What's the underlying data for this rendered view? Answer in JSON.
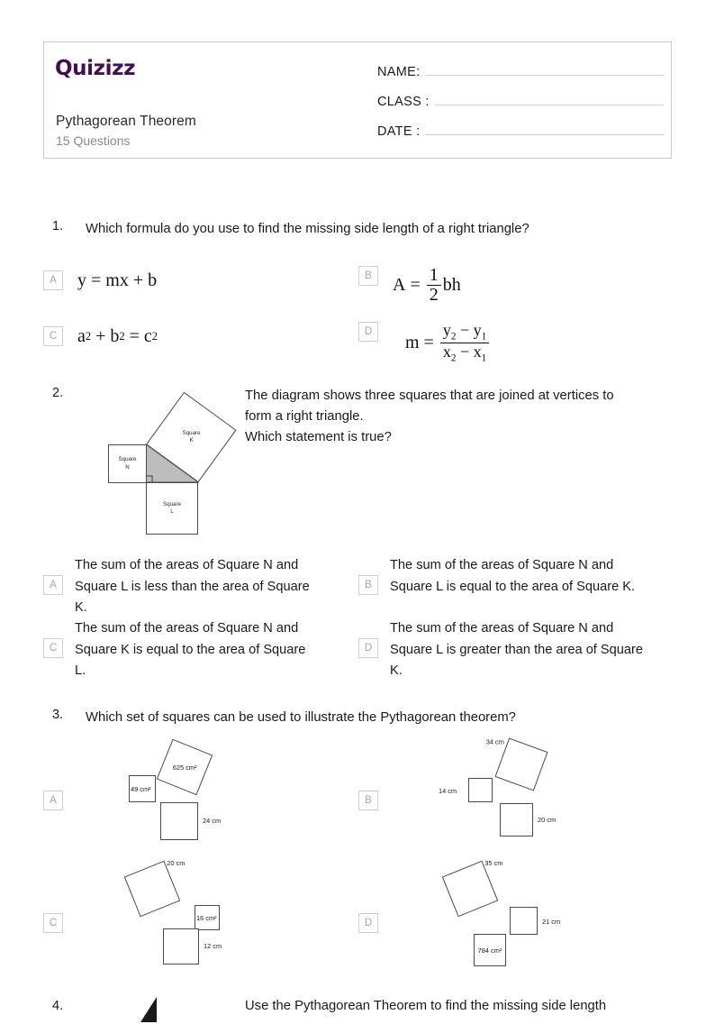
{
  "header": {
    "logo_text": "Quizizz",
    "logo_color": "#3f1052",
    "quiz_title": "Pythagorean Theorem",
    "question_count_label": "15 Questions",
    "fields": [
      {
        "label": "NAME:",
        "value": ""
      },
      {
        "label": "CLASS :",
        "value": ""
      },
      {
        "label": "DATE :",
        "value": ""
      }
    ]
  },
  "questions": [
    {
      "number": "1.",
      "prompt": "Which formula do you use to find the missing side length of a right triangle?",
      "options": [
        {
          "letter": "A",
          "math": "y = mx + b"
        },
        {
          "letter": "B",
          "math": "A = 1/2 bh"
        },
        {
          "letter": "C",
          "math": "a² + b² = c²"
        },
        {
          "letter": "D",
          "math": "m = (y₂ − y₁)/(x₂ − x₁)"
        }
      ]
    },
    {
      "number": "2.",
      "prompt_line1": "The diagram shows three squares that are joined at vertices to",
      "prompt_line2": "form a right triangle.",
      "prompt_line3": "Which statement is true?",
      "diagram": {
        "squares": [
          {
            "name": "square-n",
            "label_line1": "Square",
            "label_line2": "N"
          },
          {
            "name": "square-k",
            "label_line1": "Square",
            "label_line2": "K"
          },
          {
            "name": "square-l",
            "label_line1": "Square",
            "label_line2": "L"
          }
        ],
        "shaded_triangle": true,
        "right_angle_marker": true
      },
      "options": [
        {
          "letter": "A",
          "text": "The sum of the areas of Square N and Square L is less than the area of Square K."
        },
        {
          "letter": "B",
          "text": "The sum of the areas of Square N and Square L is equal to the area of Square K."
        },
        {
          "letter": "C",
          "text": "The sum of the areas of Square N and Square K is equal to the area of Square L."
        },
        {
          "letter": "D",
          "text": "The sum of the areas of Square N and Square L is greater than the area of Square K."
        }
      ]
    },
    {
      "number": "3.",
      "prompt": "Which set of squares can be used to illustrate the Pythagorean theorem?",
      "options": [
        {
          "letter": "A",
          "labels": {
            "small": "49 cm²",
            "rotated": "625 cm²",
            "bottom": "24 cm"
          }
        },
        {
          "letter": "B",
          "labels": {
            "small": "14 cm",
            "rotated": "34 cm",
            "bottom": "20 cm"
          }
        },
        {
          "letter": "C",
          "labels": {
            "rotated": "20 cm",
            "small": "16 cm²",
            "bottom": "12 cm"
          }
        },
        {
          "letter": "D",
          "labels": {
            "rotated": "35 cm",
            "small": "21 cm",
            "bottom": "784 cm²"
          }
        }
      ]
    },
    {
      "number": "4.",
      "prompt": "Use the Pythagorean Theorem to find the missing side length"
    }
  ]
}
